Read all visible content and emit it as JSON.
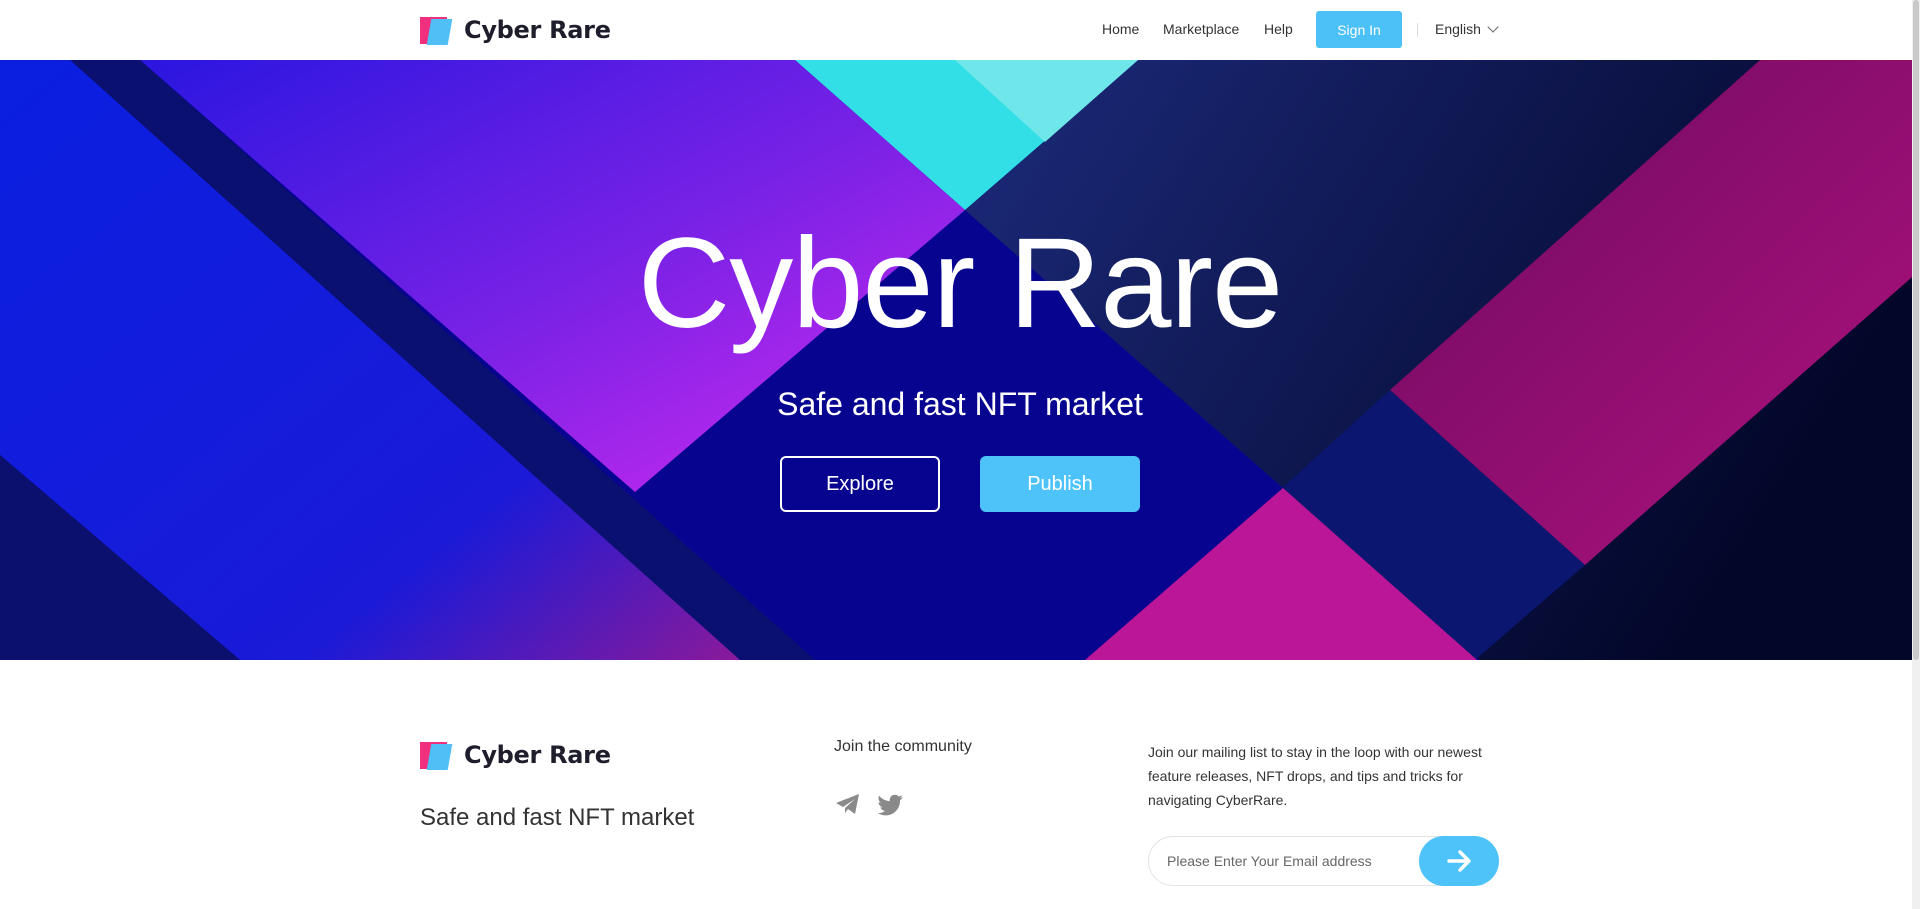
{
  "header": {
    "logo_text": "Cyber Rare",
    "nav": [
      "Home",
      "Marketplace",
      "Help"
    ],
    "signin_label": "Sign In",
    "language": "English"
  },
  "hero": {
    "title": "Cyber Rare",
    "subtitle": "Safe and fast NFT market",
    "explore_label": "Explore",
    "publish_label": "Publish"
  },
  "footer": {
    "logo_text": "Cyber Rare",
    "tagline": "Safe and fast NFT market",
    "community_title": "Join the community",
    "mailing_text": "Join our mailing list to stay in the loop with our newest feature releases, NFT drops, and tips and tricks for navigating CyberRare.",
    "email_placeholder": "Please Enter Your Email address"
  },
  "colors": {
    "accent": "#4ec3fa",
    "logo_pink": "#f0307f",
    "logo_blue": "#4fbff5",
    "hero_navy": "#07058f"
  },
  "icons": {
    "telegram": "telegram-icon",
    "twitter": "twitter-icon",
    "submit": "arrow-right-icon",
    "language": "chevron-down-icon"
  }
}
